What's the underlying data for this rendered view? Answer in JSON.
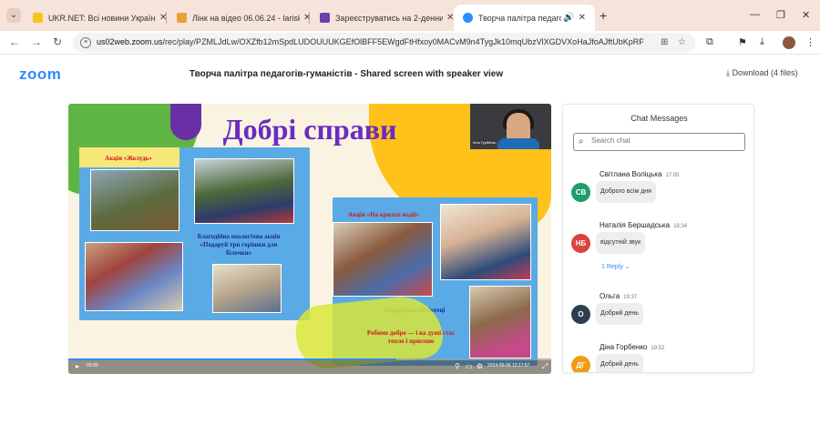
{
  "browser": {
    "tabs": [
      {
        "title": "UKR.NET: Всі новини України,",
        "favicon_color": "#f5c518",
        "active": false
      },
      {
        "title": "Лінк на відео 06.06.24 - larisk",
        "favicon_color": "#e8a23a",
        "active": false
      },
      {
        "title": "Зареєструватись на 2-денний",
        "favicon_color": "#6b3fb0",
        "active": false
      },
      {
        "title": "Творча палітра педагогів",
        "favicon_color": "#2d8cff",
        "active": true
      }
    ],
    "new_tab_icon": "plus-icon",
    "url_domain": "us02web.zoom.us",
    "url_path": "/rec/play/PZMLJdLw/OXZfb12mSpdLUDOUUUKGEfOlBFF5EWgdFtHfxoy0MACvM9n4TygJk10mqUbzVlXGDVXoHaJfoAJftUbKpRPSL..."
  },
  "zoom": {
    "logo": "zoom",
    "title": "Творча палітра педагогів-гуманістів - Shared screen with speaker view",
    "download": "Download (4 files)"
  },
  "video": {
    "slide_title": "Добрі справи",
    "captions": {
      "zholud": "Акція «Жолудь»",
      "eco": "Благодійна екологічна акція «Подаруй три горішки для білочки»",
      "krylakh": "Акція «На крилах надії»",
      "podarunok": "Подарунок бібліотеці",
      "robimo": "Робимо добро — і на душі стає тепло і приємно"
    },
    "speaker_name": "Інна Гурбенко",
    "playback_time": "00:00",
    "timestamp": "2024-06-06 12:17:57",
    "progress_fraction": 0.68,
    "colors": {
      "title": "#6a2bc2",
      "green": "#5fb544",
      "yellow": "#ffc21a",
      "panel": "#5aaae6"
    }
  },
  "chat": {
    "title": "Chat Messages",
    "search_placeholder": "Search chat",
    "messages": [
      {
        "initials": "СВ",
        "color": "#1f9d6b",
        "name": "Світлана Воліцька",
        "time": "17:05",
        "text": "Доброго всім дня",
        "reply": ""
      },
      {
        "initials": "НБ",
        "color": "#d9443b",
        "name": "Наталія Бершадська",
        "time": "18:34",
        "text": "відсутній звук",
        "reply": "1 Reply"
      },
      {
        "initials": "О",
        "color": "#2c3e50",
        "name": "Ольга",
        "time": "19:37",
        "text": "Добрий день",
        "reply": ""
      },
      {
        "initials": "ДГ",
        "color": "#f39c12",
        "name": "Діна Горбенко",
        "time": "19:52",
        "text": "Добрий день",
        "reply": ""
      }
    ]
  }
}
